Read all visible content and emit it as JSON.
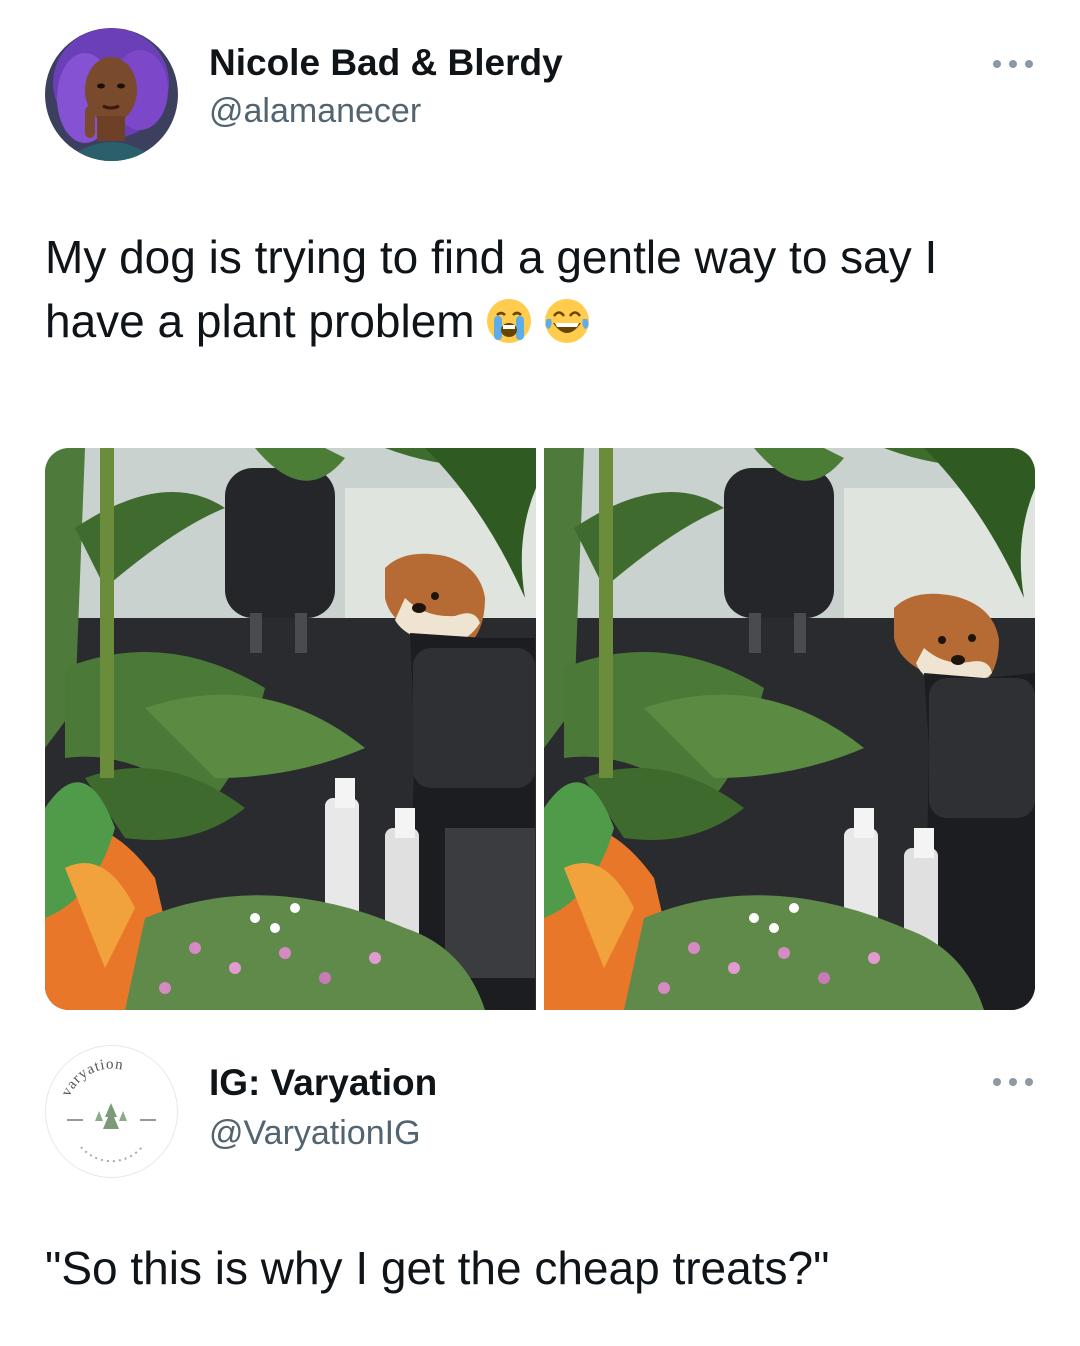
{
  "tweet": {
    "author_name": "Nicole Bad & Blerdy",
    "author_handle": "@alamanecer",
    "text": "My dog is trying to find a gentle way to say I have a plant problem",
    "emojis": [
      "loudly-crying-face-icon",
      "face-with-tears-of-joy-icon"
    ],
    "more_icon": "more-dots-icon"
  },
  "reply": {
    "author_name": "IG: Varyation",
    "author_handle": "@VaryationIG",
    "avatar_text": "varyation",
    "text": "\"So this is why I get the cheap treats?\"",
    "more_icon": "more-dots-icon"
  },
  "colors": {
    "text": "#0f1419",
    "secondary": "#536471",
    "avatar_hair": "#6a3fb8"
  }
}
